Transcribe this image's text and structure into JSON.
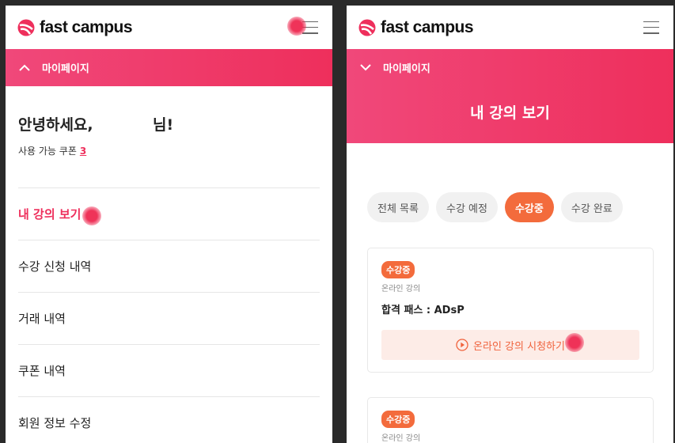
{
  "brand": {
    "name": "fast campus",
    "accent": "#ee2f5c",
    "orange": "#f36b3c"
  },
  "left": {
    "section_label": "마이페이지",
    "greeting_hello": "안녕하세요,",
    "greeting_suffix": "님!",
    "coupon_label": "사용 가능 쿠폰",
    "coupon_count": "3",
    "menu": [
      {
        "label": "내 강의 보기",
        "active": true
      },
      {
        "label": "수강 신청 내역"
      },
      {
        "label": "거래 내역"
      },
      {
        "label": "쿠폰 내역"
      },
      {
        "label": "회원 정보 수정"
      }
    ]
  },
  "right": {
    "section_label": "마이페이지",
    "page_title": "내 강의 보기",
    "filters": [
      {
        "label": "전체 목록"
      },
      {
        "label": "수강 예정"
      },
      {
        "label": "수강중",
        "active": true
      },
      {
        "label": "수강 완료"
      }
    ],
    "courses": [
      {
        "badge": "수강중",
        "type": "온라인 강의",
        "title": "합격 패스 : ADsP",
        "action": "온라인 강의 시청하기"
      },
      {
        "badge": "수강중",
        "type": "온라인 강의"
      }
    ]
  }
}
